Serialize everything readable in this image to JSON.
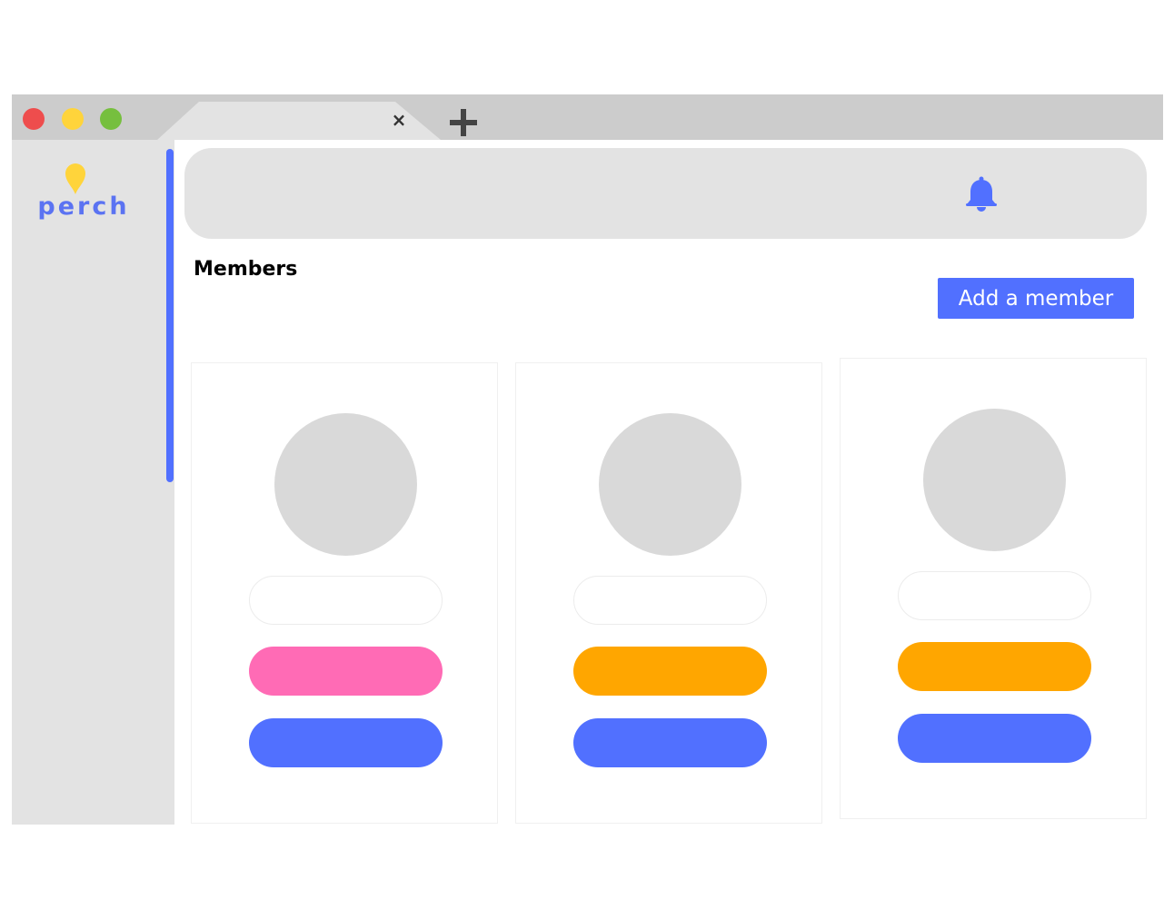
{
  "window": {
    "traffic_lights": [
      {
        "name": "close-window-button",
        "color": "#ee4d4d"
      },
      {
        "name": "minimize-window-button",
        "color": "#ffd43b"
      },
      {
        "name": "maximize-window-button",
        "color": "#76bf3e"
      }
    ],
    "tab": {
      "close_label": "×",
      "close_icon": "close-icon"
    },
    "new_tab_icon": "plus-icon"
  },
  "sidebar": {
    "logo_text": "perch",
    "logo_pin_color": "#ffd43b",
    "scrollbar_color": "#5170ff"
  },
  "header": {
    "notification_icon": "bell-icon"
  },
  "main": {
    "title": "Members",
    "add_button_label": "Add a member"
  },
  "members": [
    {
      "role_color": "#ff6bb5",
      "action_color": "#5170ff"
    },
    {
      "role_color": "#ffa600",
      "action_color": "#5170ff"
    },
    {
      "role_color": "#ffa600",
      "action_color": "#5170ff"
    }
  ],
  "colors": {
    "accent": "#5170ff",
    "sidebar_bg": "#e3e3e3",
    "titlebar_bg": "#cccccc",
    "avatar_placeholder": "#d9d9d9"
  }
}
